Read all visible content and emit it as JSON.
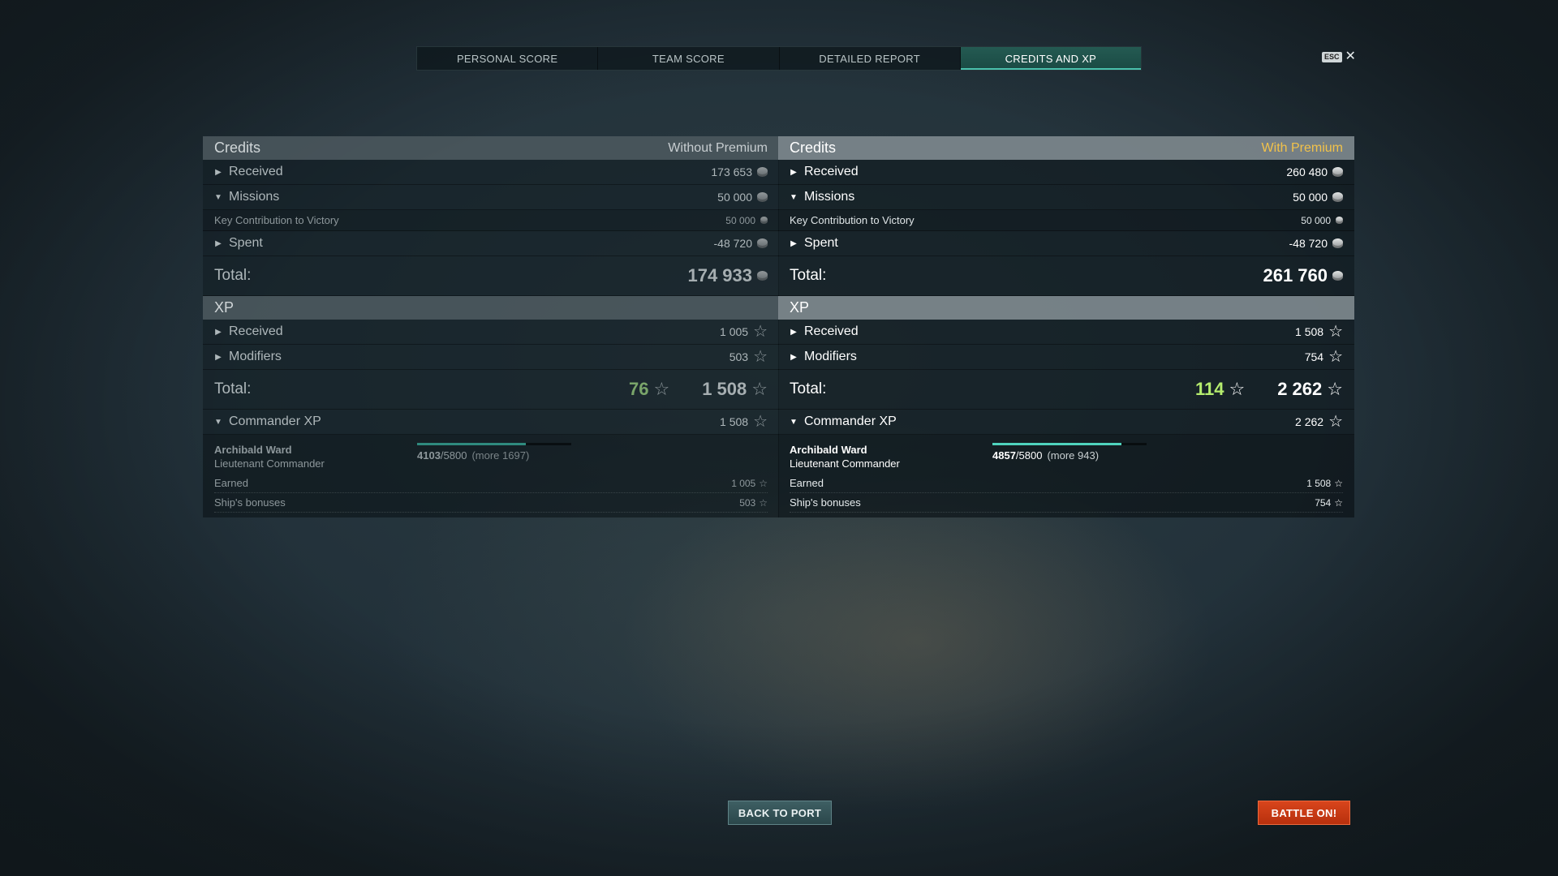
{
  "tabs": [
    {
      "label": "PERSONAL SCORE",
      "active": false
    },
    {
      "label": "TEAM SCORE",
      "active": false
    },
    {
      "label": "DETAILED REPORT",
      "active": false
    },
    {
      "label": "CREDITS AND XP",
      "active": true
    }
  ],
  "esc_label": "ESC",
  "close_icon": "close-icon",
  "panels": {
    "left": {
      "credits": {
        "title": "Credits",
        "subtitle": "Without Premium",
        "received": {
          "label": "Received",
          "value": "173 653"
        },
        "missions": {
          "label": "Missions",
          "value": "50 000"
        },
        "key_contribution": {
          "label": "Key Contribution to Victory",
          "value": "50 000"
        },
        "spent": {
          "label": "Spent",
          "value": "-48 720"
        },
        "total": {
          "label": "Total:",
          "value": "174 933"
        }
      },
      "xp": {
        "title": "XP",
        "received": {
          "label": "Received",
          "value": "1 005"
        },
        "modifiers": {
          "label": "Modifiers",
          "value": "503"
        },
        "total": {
          "label": "Total:",
          "bonus": "76",
          "value": "1 508"
        },
        "commander_xp": {
          "label": "Commander XP",
          "value": "1 508"
        }
      },
      "commander": {
        "name": "Archibald Ward",
        "rank": "Lieutenant Commander",
        "progress_current": "4103",
        "progress_max": "/5800",
        "progress_more": "(more 1697)",
        "progress_fraction": 0.707,
        "earned": {
          "label": "Earned",
          "value": "1 005"
        },
        "ship_bonuses": {
          "label": "Ship's bonuses",
          "value": "503"
        }
      }
    },
    "right": {
      "credits": {
        "title": "Credits",
        "subtitle": "With Premium",
        "received": {
          "label": "Received",
          "value": "260 480"
        },
        "missions": {
          "label": "Missions",
          "value": "50 000"
        },
        "key_contribution": {
          "label": "Key Contribution to Victory",
          "value": "50 000"
        },
        "spent": {
          "label": "Spent",
          "value": "-48 720"
        },
        "total": {
          "label": "Total:",
          "value": "261 760"
        }
      },
      "xp": {
        "title": "XP",
        "received": {
          "label": "Received",
          "value": "1 508"
        },
        "modifiers": {
          "label": "Modifiers",
          "value": "754"
        },
        "total": {
          "label": "Total:",
          "bonus": "114",
          "value": "2 262"
        },
        "commander_xp": {
          "label": "Commander XP",
          "value": "2 262"
        }
      },
      "commander": {
        "name": "Archibald Ward",
        "rank": "Lieutenant Commander",
        "progress_current": "4857",
        "progress_max": "/5800",
        "progress_more": "(more 943)",
        "progress_fraction": 0.837,
        "earned": {
          "label": "Earned",
          "value": "1 508"
        },
        "ship_bonuses": {
          "label": "Ship's bonuses",
          "value": "754"
        }
      }
    }
  },
  "buttons": {
    "back_to_port": "BACK TO PORT",
    "battle_on": "BATTLE ON!"
  },
  "colors": {
    "premium_accent": "#f2c24a",
    "active_tab": "#245a52",
    "battle_button": "#d8451c",
    "bonus_green": "#b5ec6e"
  },
  "icons": {
    "credits": "coin-icon",
    "xp": "star-icon",
    "expand": "caret-right-icon",
    "collapse": "caret-down-icon"
  }
}
